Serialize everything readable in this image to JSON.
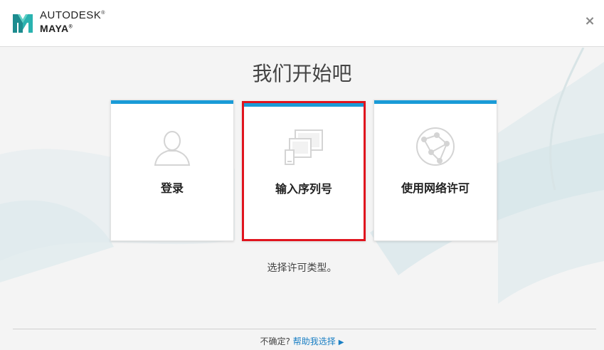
{
  "header": {
    "brand_line1": "AUTODESK",
    "brand_line2": "MAYA",
    "registered_mark": "®",
    "close_label": "×"
  },
  "main": {
    "title": "我们开始吧",
    "cards": [
      {
        "id": "login",
        "label": "登录",
        "icon": "user-icon"
      },
      {
        "id": "serial",
        "label": "输入序列号",
        "icon": "devices-icon",
        "highlighted": true
      },
      {
        "id": "network",
        "label": "使用网络许可",
        "icon": "network-globe-icon"
      }
    ],
    "hint": "选择许可类型。"
  },
  "footer": {
    "question": "不确定?",
    "help_link": "帮助我选择"
  },
  "colors": {
    "accent_bar": "#1a9bd7",
    "highlight_border": "#e0141e",
    "link": "#1a7fc4"
  }
}
